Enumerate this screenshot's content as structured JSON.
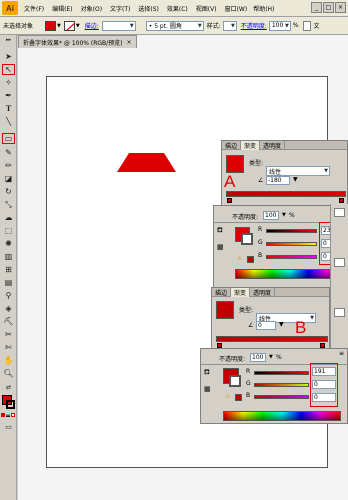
{
  "app": {
    "logo_text": "Ai"
  },
  "menus": [
    "文件(F)",
    "编辑(E)",
    "对象(O)",
    "文字(T)",
    "选择(S)",
    "效果(C)",
    "视图(V)",
    "窗口(W)",
    "帮助(H)"
  ],
  "window_buttons": [
    "_",
    "□",
    "×"
  ],
  "control_bar": {
    "selection_label": "未选择对象",
    "stroke_label": "描边:",
    "brush_value": "• 5 pt. 圆角",
    "style_label": "样式:",
    "opacity_label": "不透明度:",
    "opacity_value": "100",
    "percent": "%",
    "overflow_label": "文"
  },
  "document": {
    "tab_title": "折叠字体效果* @ 100% (RGB/预览)",
    "close": "×"
  },
  "shape": {
    "fill": "#dd0000"
  },
  "panel_a": {
    "tabs": [
      "描边",
      "渐变",
      "透明度"
    ],
    "type_label": "类型:",
    "type_value": "线性",
    "angle_value": "-180",
    "opacity_label": "不透明度:",
    "opacity_value": "100",
    "percent": "%",
    "channels": [
      {
        "name": "R",
        "value": "237"
      },
      {
        "name": "G",
        "value": "0"
      },
      {
        "name": "B",
        "value": "0"
      }
    ],
    "callout_letter": "A"
  },
  "panel_b": {
    "tabs": [
      "描边",
      "渐变",
      "透明度"
    ],
    "type_label": "类型:",
    "type_value": "线性",
    "angle_value": "0",
    "opacity_label": "不透明度:",
    "opacity_value": "100",
    "percent": "%",
    "channels": [
      {
        "name": "R",
        "value": "191"
      },
      {
        "name": "G",
        "value": "0"
      },
      {
        "name": "B",
        "value": "0"
      }
    ],
    "callout_letter": "B"
  },
  "colors": {
    "accent_red": "#e00000",
    "panel_bg": "#d4d0c8",
    "chrome": "#ece9d8"
  }
}
